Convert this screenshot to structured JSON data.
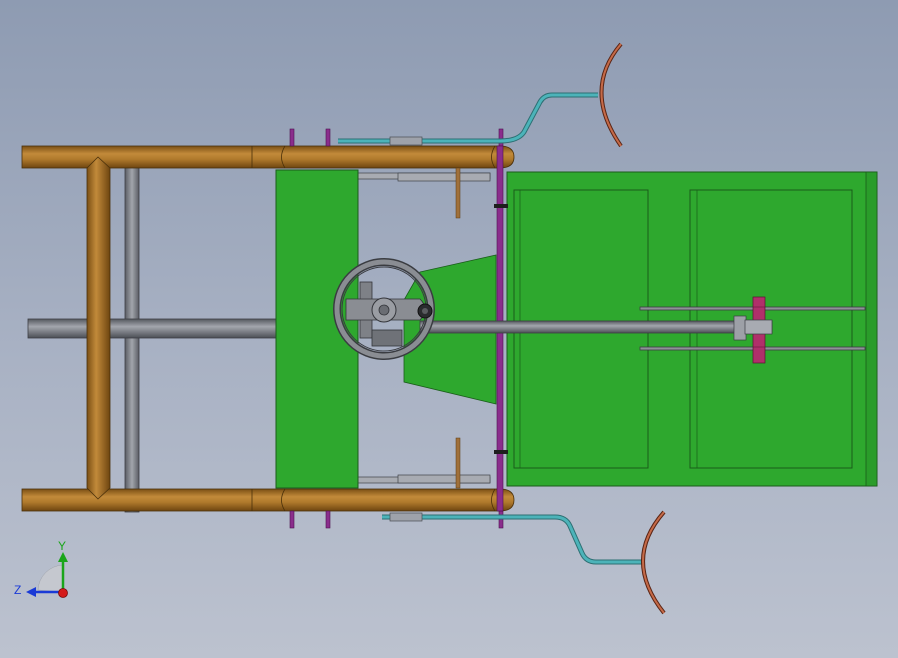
{
  "triad": {
    "y_label": "Y",
    "z_label": "Z",
    "y_color": "#1aa51a",
    "z_color": "#1a3ad6",
    "x_color": "#d41a1a"
  },
  "colors": {
    "background_top": "#8e9bb2",
    "background_bottom": "#bcc2cf",
    "frame_tube": "#b07a2c",
    "panel_green": "#2ea82e",
    "shaft_gray": "#7d8088",
    "hose_teal": "#4cb3b9",
    "bracket_purple": "#8a2d8c",
    "blade_copper": "#b85a3a"
  }
}
